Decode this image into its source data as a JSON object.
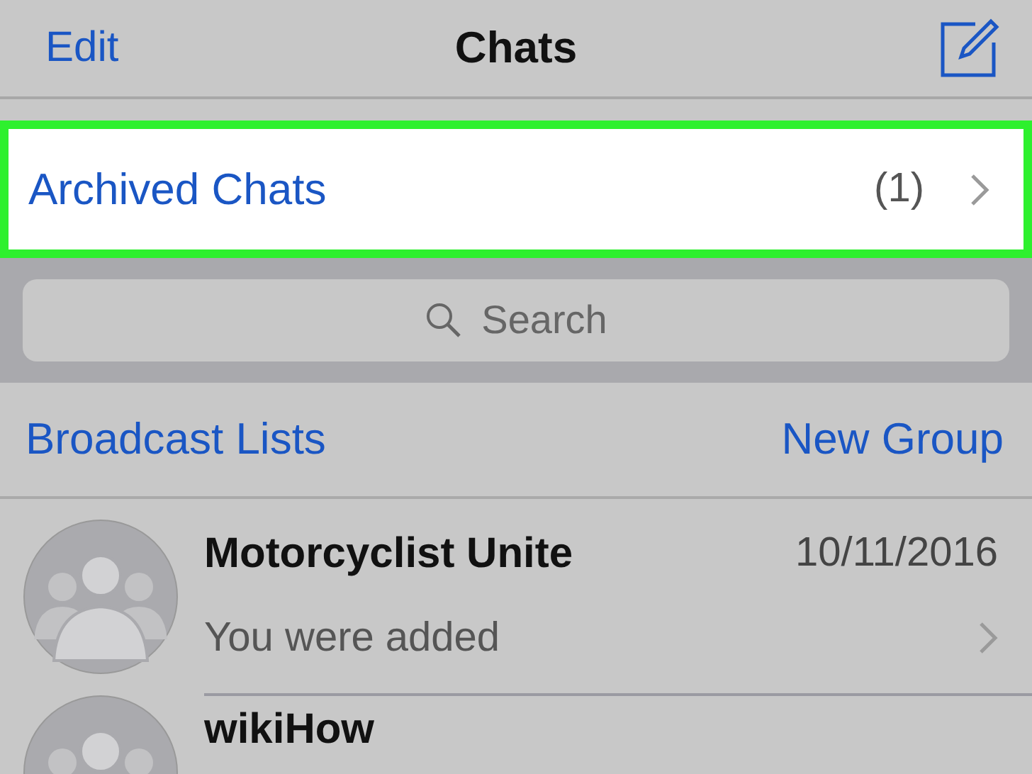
{
  "nav_bar": {
    "left_button": "Edit",
    "title": "Chats"
  },
  "archived": {
    "label": "Archived Chats",
    "count": "(1)",
    "highlighted": true
  },
  "search": {
    "placeholder": "Search"
  },
  "links": {
    "left": "Broadcast Lists",
    "right": "New Group"
  },
  "chats": [
    {
      "name": "Motorcyclist Unite",
      "date": "10/11/2016",
      "preview": "You were added",
      "kind": "group"
    },
    {
      "name": "wikiHow",
      "kind": "group"
    }
  ]
}
